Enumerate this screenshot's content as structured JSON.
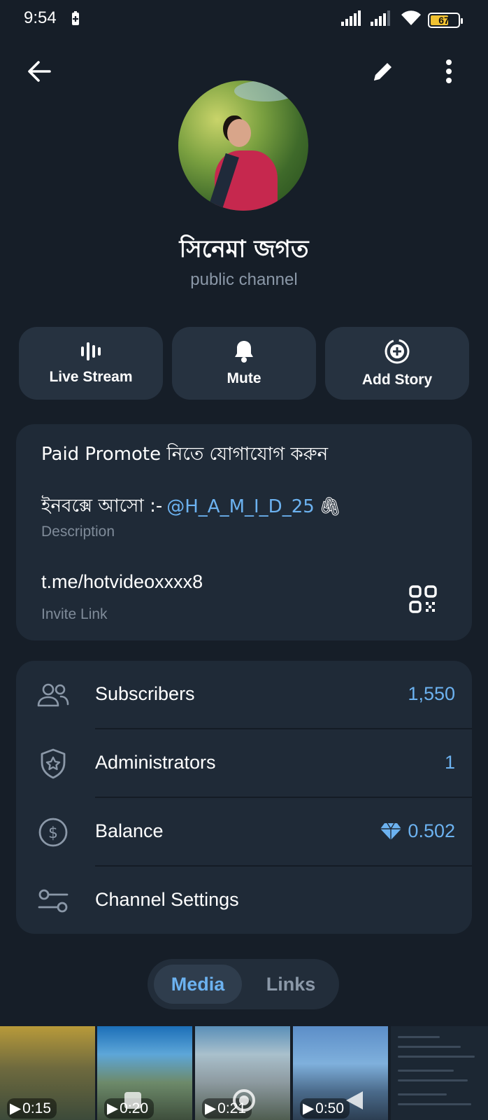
{
  "status_bar": {
    "time": "9:54",
    "battery_level": "67",
    "battery_fraction": 0.67
  },
  "header": {
    "channel_name": "সিনেমা জগত",
    "channel_type": "public channel"
  },
  "actions": {
    "live_stream": "Live Stream",
    "mute": "Mute",
    "add_story": "Add Story"
  },
  "info": {
    "description_line1": "Paid Promote নিতে যোগাযোগ করুন",
    "description_line2_prefix": "ইনবক্সে আসো :- ",
    "description_handle": "@H_A_M_I_D_25",
    "description_emoji": "🖇",
    "description_caption": "Description",
    "invite_link": "t.me/hotvideoxxxx8",
    "invite_caption": "Invite Link"
  },
  "stats": {
    "subscribers_label": "Subscribers",
    "subscribers_value": "1,550",
    "administrators_label": "Administrators",
    "administrators_value": "1",
    "balance_label": "Balance",
    "balance_value": "0.502",
    "settings_label": "Channel Settings"
  },
  "tabs": {
    "media": "Media",
    "links": "Links"
  },
  "media": [
    {
      "duration": "0:15"
    },
    {
      "duration": "0:20"
    },
    {
      "duration": "0:21"
    },
    {
      "duration": "0:50"
    }
  ],
  "colors": {
    "background": "#161e28",
    "card": "#1f2a37",
    "accent": "#6cb2f0",
    "muted": "#7f8b99"
  }
}
